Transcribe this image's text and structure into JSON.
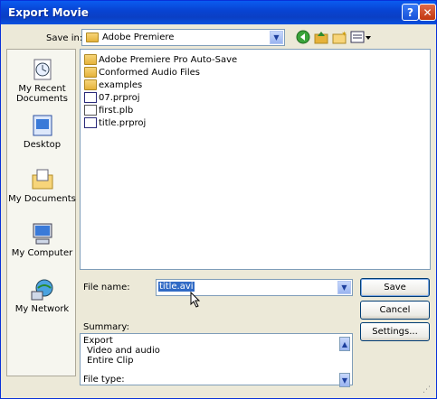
{
  "window": {
    "title": "Export Movie",
    "help_label": "?",
    "close_label": "✕"
  },
  "save_in": {
    "label": "Save in:",
    "value": "Adobe Premiere",
    "tools": [
      "back-icon",
      "up-folder-icon",
      "new-folder-icon",
      "view-menu-icon"
    ]
  },
  "places": [
    {
      "name": "recent",
      "label": "My Recent Documents"
    },
    {
      "name": "desktop",
      "label": "Desktop"
    },
    {
      "name": "documents",
      "label": "My Documents"
    },
    {
      "name": "computer",
      "label": "My Computer"
    },
    {
      "name": "network",
      "label": "My Network"
    }
  ],
  "files": [
    {
      "name": "Adobe Premiere Pro Auto-Save",
      "icon": "folder-icon"
    },
    {
      "name": "Conformed Audio Files",
      "icon": "folder-icon"
    },
    {
      "name": "examples",
      "icon": "folder-icon"
    },
    {
      "name": "07.prproj",
      "icon": "prproj-icon"
    },
    {
      "name": "first.plb",
      "icon": "plb-icon"
    },
    {
      "name": "title.prproj",
      "icon": "prproj-icon"
    }
  ],
  "file_name": {
    "label": "File name:",
    "value": "title.avi"
  },
  "buttons": {
    "save": "Save",
    "cancel": "Cancel",
    "settings": "Settings..."
  },
  "summary": {
    "label": "Summary:",
    "lines": [
      "Export",
      "Video and audio",
      "Entire Clip"
    ]
  },
  "file_type": {
    "label": "File type:"
  }
}
